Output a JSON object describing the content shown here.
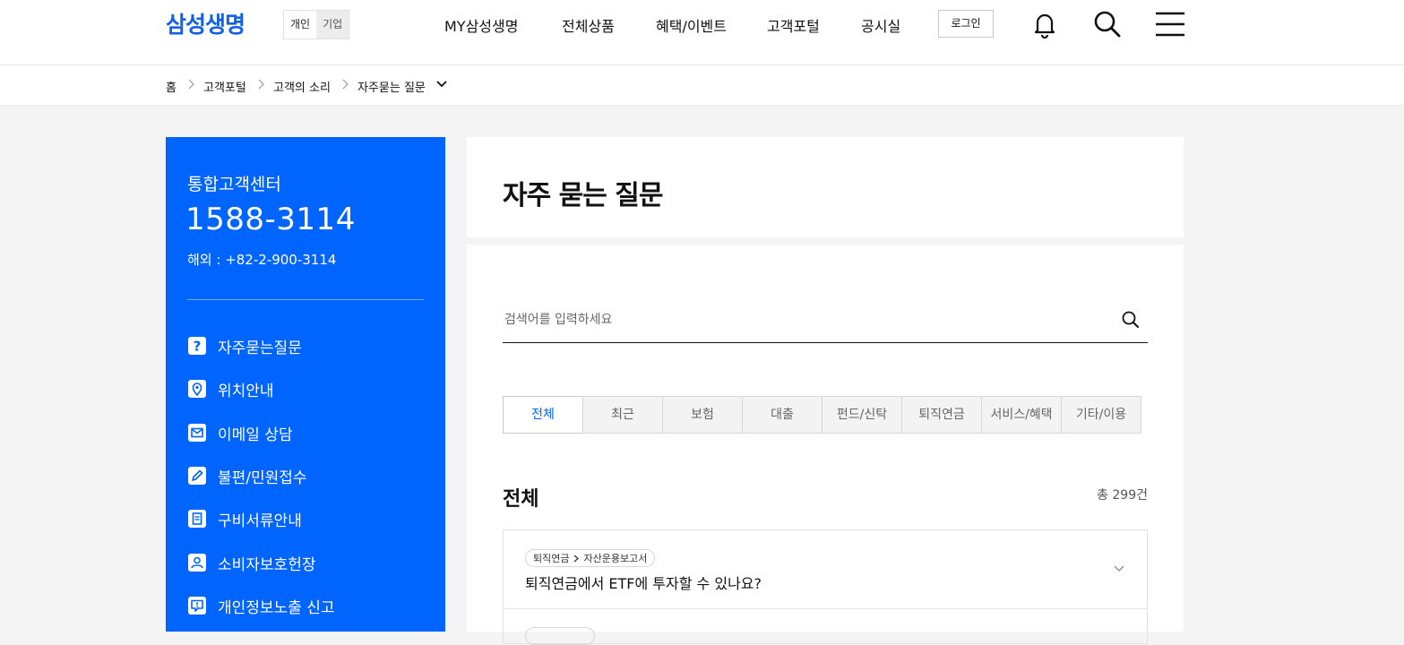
{
  "header": {
    "logo": "삼성생명",
    "segment": [
      "개인",
      "기업"
    ],
    "nav": [
      "MY삼성생명",
      "전체상품",
      "혜택/이벤트",
      "고객포털",
      "공시실"
    ],
    "login": "로그인",
    "icons": [
      "bell-icon",
      "search-icon",
      "menu-icon"
    ]
  },
  "breadcrumb": [
    "홈",
    "고객포털",
    "고객의 소리",
    "자주묻는 질문"
  ],
  "sidebar": {
    "title": "통합고객센터",
    "phone": "1588-3114",
    "overseas": "해외 : +82-2-900-3114",
    "items": [
      {
        "label": "자주묻는질문",
        "icon": "question-icon"
      },
      {
        "label": "위치안내",
        "icon": "location-pin-icon"
      },
      {
        "label": "이메일 상담",
        "icon": "mail-icon"
      },
      {
        "label": "불편/민원접수",
        "icon": "pencil-icon"
      },
      {
        "label": "구비서류안내",
        "icon": "document-icon"
      },
      {
        "label": "소비자보호헌장",
        "icon": "user-icon"
      },
      {
        "label": "개인정보노출 신고",
        "icon": "alert-chat-icon"
      }
    ]
  },
  "main": {
    "title": "자주 묻는 질문",
    "search_placeholder": "검색어를 입력하세요",
    "tabs": [
      "전체",
      "최근",
      "보험",
      "대출",
      "펀드/신탁",
      "퇴직연금",
      "서비스/혜택",
      "기타/이용"
    ],
    "active_tab": "전체",
    "section_title": "전체",
    "count": "총 299건",
    "faqs": [
      {
        "category": "퇴직연금",
        "subcategory": "자산운용보고서",
        "question": "퇴직연금에서 ETF에 투자할 수 있나요?"
      }
    ]
  },
  "colors": {
    "brand": "#0064ff",
    "logo": "#1160e6"
  }
}
